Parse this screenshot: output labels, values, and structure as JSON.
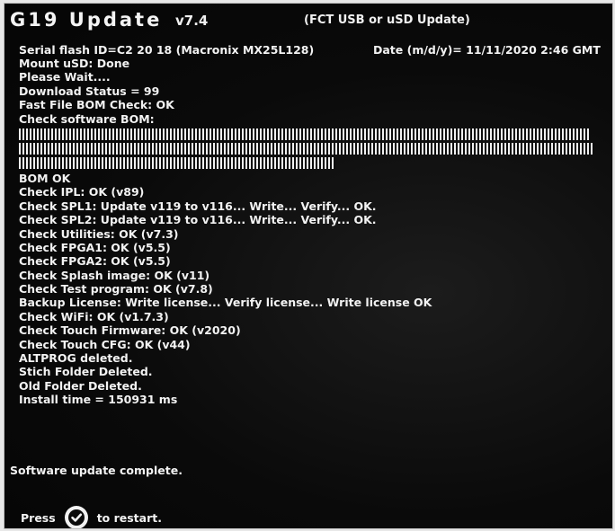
{
  "header": {
    "title": "G19 Update",
    "version": "v7.4",
    "subtitle": "(FCT USB or uSD Update)"
  },
  "serial_line": {
    "serial": "Serial flash ID=C2 20 18 (Macronix MX25L128)",
    "date": "Date (m/d/y)= 11/11/2020  2:46 GMT"
  },
  "log_before": [
    "Mount uSD: Done",
    "Please Wait....",
    "Download Status = 99",
    "Fast File BOM Check: OK",
    "Check software BOM:"
  ],
  "progress": {
    "rows_full": 2,
    "last_row_fraction": 0.55
  },
  "log_after": [
    "BOM OK",
    "Check IPL: OK (v89)",
    "Check SPL1: Update v119 to v116... Write...  Verify...  OK.",
    "Check SPL2: Update v119 to v116... Write...  Verify...  OK.",
    "Check Utilities: OK (v7.3)",
    "Check FPGA1: OK (v5.5)",
    "Check FPGA2: OK (v5.5)",
    "Check Splash image: OK (v11)",
    "Check Test program: OK (v7.8)",
    "Backup License:  Write license...  Verify license...  Write license OK",
    "Check WiFi: OK (v1.7.3)",
    "Check Touch Firmware: OK (v2020)",
    "Check Touch CFG: OK (v44)",
    "ALTPROG deleted.",
    "Stich Folder Deleted.",
    "Old Folder Deleted.",
    "Install time = 150931 ms"
  ],
  "footer": {
    "complete": "Software update complete.",
    "press_label": "Press",
    "restart_label": "to restart.",
    "restart_icon": "checkmark-circle-icon"
  }
}
